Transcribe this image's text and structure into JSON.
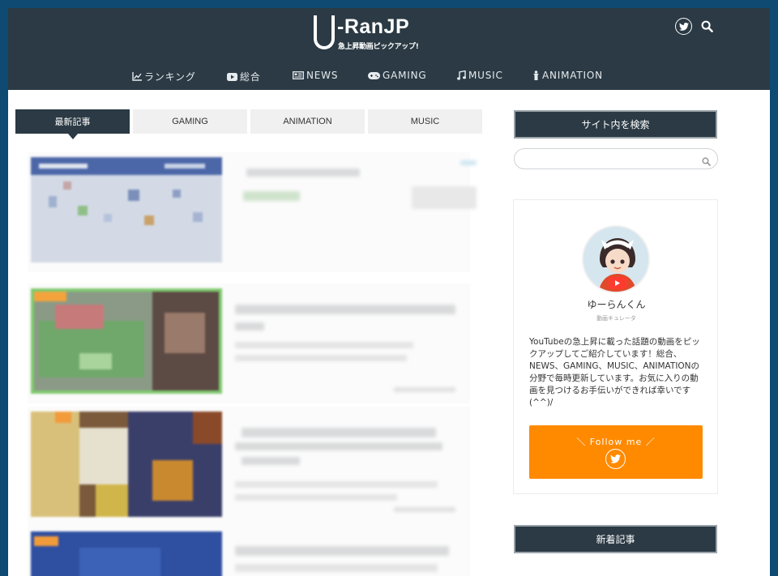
{
  "site": {
    "logo_text": "-RanJP",
    "tagline": "急上昇動画ピックアップ!"
  },
  "header_icons": {
    "twitter": "twitter-icon",
    "search": "search-icon"
  },
  "nav": [
    {
      "label": "ランキング",
      "icon": "chart-line-icon"
    },
    {
      "label": "総合",
      "icon": "youtube-icon"
    },
    {
      "label": "NEWS",
      "icon": "newspaper-icon"
    },
    {
      "label": "GAMING",
      "icon": "gamepad-icon"
    },
    {
      "label": "MUSIC",
      "icon": "music-note-icon"
    },
    {
      "label": "ANIMATION",
      "icon": "figure-icon"
    }
  ],
  "tabs": [
    "最新記事",
    "GAMING",
    "ANIMATION",
    "MUSIC"
  ],
  "active_tab": "最新記事",
  "sidebar": {
    "search_heading": "サイト内を検索",
    "search_placeholder": "",
    "profile": {
      "name": "ゆーらんくん",
      "role": "動画キュレータ",
      "description": "YouTubeの急上昇に載った話題の動画をピックアップしてご紹介しています！総合、NEWS、GAMING、MUSIC、ANIMATIONの分野で毎時更新しています。お気に入りの動画を見つけるお手伝いができれば幸いです(^^)/",
      "follow_label": "＼ Follow me ／"
    },
    "new_articles_heading": "新着記事"
  },
  "colors": {
    "header_bg": "#2b3a44",
    "page_border": "#0e4a72",
    "follow_button": "#ff8a00",
    "tab_inactive": "#f0f0f0"
  }
}
